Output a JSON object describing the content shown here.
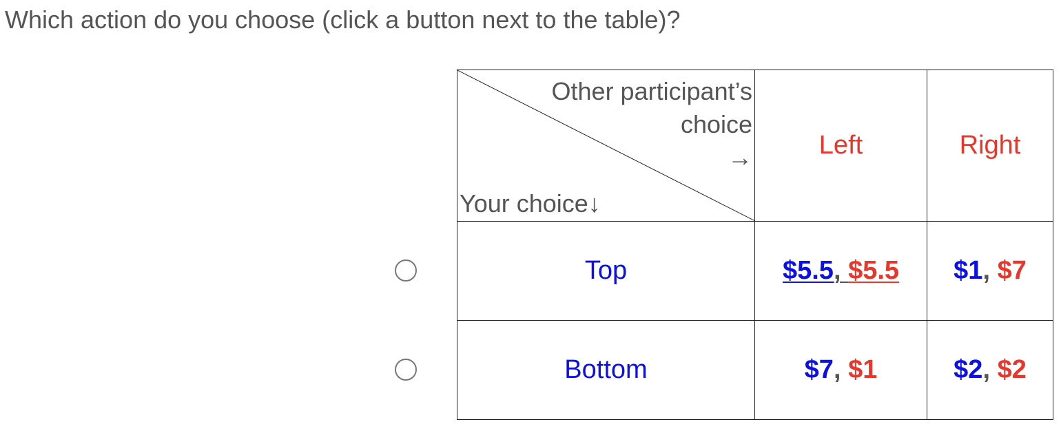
{
  "question": "Which action do you choose (click a button next to the table)?",
  "table": {
    "corner": {
      "other_line1": "Other participant’s",
      "other_line2": "choice",
      "other_arrow": "→",
      "your": "Your choice↓"
    },
    "columns": [
      "Left",
      "Right"
    ],
    "rows": [
      {
        "label": "Top",
        "cells": [
          {
            "you": "$5.5",
            "sep": ", ",
            "other": "$5.5",
            "underlined": true
          },
          {
            "you": "$1",
            "sep": ", ",
            "other": "$7"
          }
        ]
      },
      {
        "label": "Bottom",
        "cells": [
          {
            "you": "$7",
            "sep": ", ",
            "other": "$1"
          },
          {
            "you": "$2",
            "sep": ", ",
            "other": "$2"
          }
        ]
      }
    ]
  },
  "colors": {
    "your_payoff": "#0b10e6",
    "other_payoff": "#e8372a",
    "text": "#555555"
  }
}
